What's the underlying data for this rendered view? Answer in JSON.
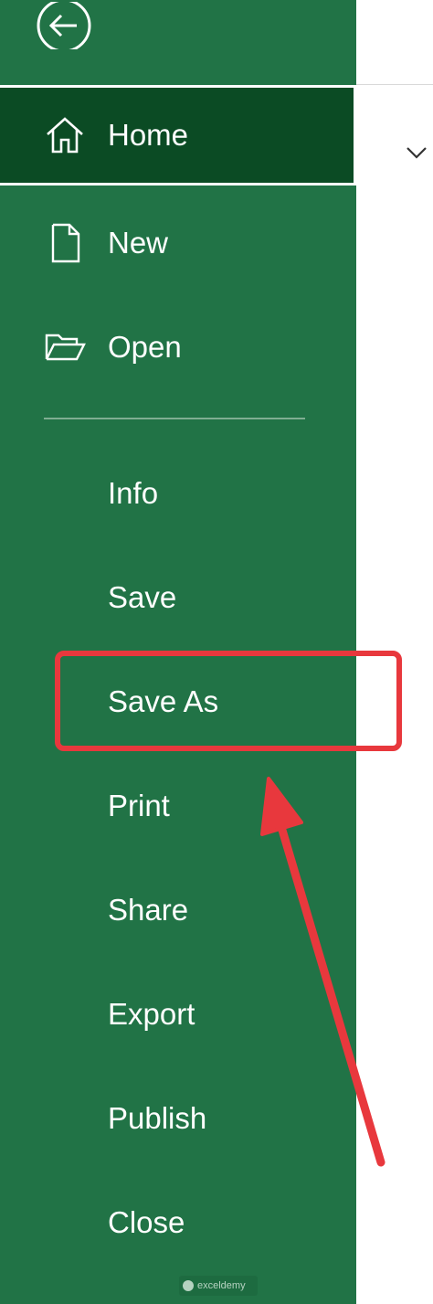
{
  "backstage": {
    "nav_top": [
      {
        "id": "home",
        "label": "Home",
        "icon": "home-icon"
      },
      {
        "id": "new",
        "label": "New",
        "icon": "new-document-icon"
      },
      {
        "id": "open",
        "label": "Open",
        "icon": "folder-open-icon"
      }
    ],
    "nav_bottom": [
      {
        "id": "info",
        "label": "Info"
      },
      {
        "id": "save",
        "label": "Save"
      },
      {
        "id": "save-as",
        "label": "Save As"
      },
      {
        "id": "print",
        "label": "Print"
      },
      {
        "id": "share",
        "label": "Share"
      },
      {
        "id": "export",
        "label": "Export"
      },
      {
        "id": "publish",
        "label": "Publish"
      },
      {
        "id": "close",
        "label": "Close"
      }
    ],
    "selected": "home",
    "highlighted": "save-as"
  },
  "colors": {
    "sidebar": "#217346",
    "selected": "#0b4b24",
    "annotation": "#e8383d"
  },
  "watermark": {
    "text": "exceldemy"
  }
}
